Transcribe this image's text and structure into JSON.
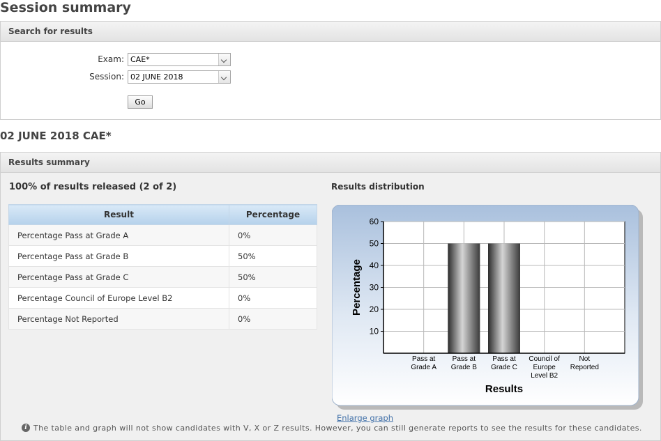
{
  "page_title": "Session summary",
  "search": {
    "header": "Search for results",
    "exam_label": "Exam:",
    "exam_value": "CAE*",
    "session_label": "Session:",
    "session_value": "02 JUNE 2018",
    "go_label": "Go"
  },
  "session_heading": "02 JUNE 2018 CAE*",
  "summary": {
    "header": "Results summary",
    "released_text": "100% of results released (2 of 2)",
    "distribution_title": "Results distribution",
    "table": {
      "headers": [
        "Result",
        "Percentage"
      ],
      "rows": [
        [
          "Percentage Pass at Grade A",
          "0%"
        ],
        [
          "Percentage Pass at Grade B",
          "50%"
        ],
        [
          "Percentage Pass at Grade C",
          "50%"
        ],
        [
          "Percentage Council of Europe Level B2",
          "0%"
        ],
        [
          "Percentage Not Reported",
          "0%"
        ]
      ]
    },
    "enlarge_link": "Enlarge graph",
    "footnote": "The table and graph will not show candidates with V, X or Z results. However, you can still generate reports to see the results for these candidates.",
    "info_icon": "info-icon"
  },
  "chart_data": {
    "type": "bar",
    "categories": [
      "Pass at Grade A",
      "Pass at Grade B",
      "Pass at Grade C",
      "Council of Europe Level B2",
      "Not Reported"
    ],
    "category_lines": [
      [
        "Pass at",
        "Grade A"
      ],
      [
        "Pass at",
        "Grade B"
      ],
      [
        "Pass at",
        "Grade C"
      ],
      [
        "Council of",
        "Europe",
        "Level B2"
      ],
      [
        "Not",
        "Reported"
      ]
    ],
    "values": [
      0,
      50,
      50,
      0,
      0
    ],
    "xlabel": "Results",
    "ylabel": "Percentage",
    "ylim": [
      0,
      60
    ],
    "yticks": [
      10,
      20,
      30,
      40,
      50,
      60
    ],
    "grid": true
  }
}
